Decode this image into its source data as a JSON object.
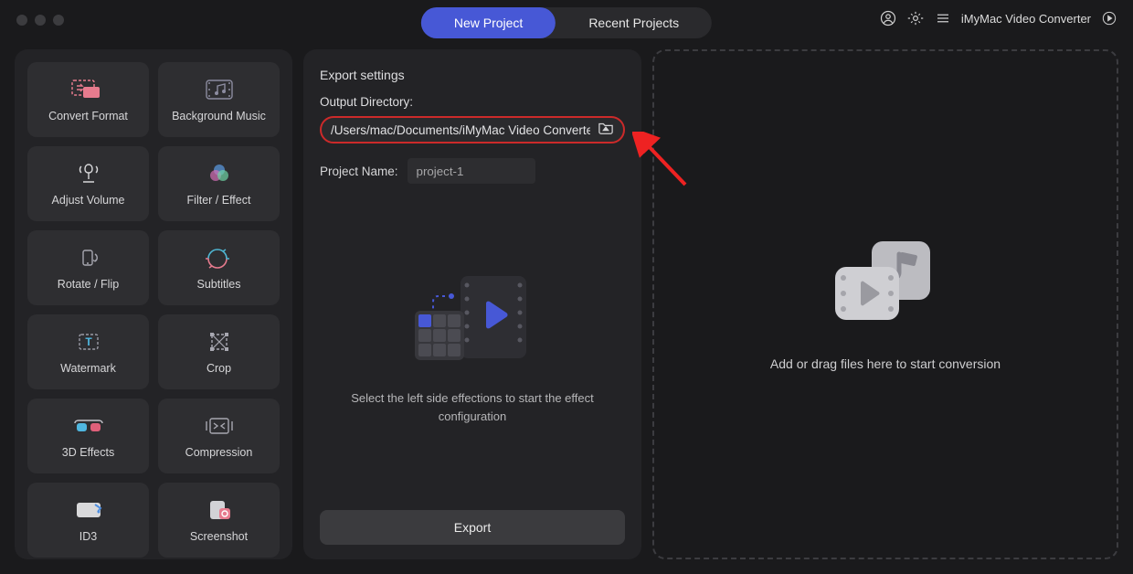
{
  "app_name": "iMyMac Video Converter",
  "tabs": {
    "new_project": "New Project",
    "recent_projects": "Recent Projects"
  },
  "tools": [
    {
      "label": "Convert Format"
    },
    {
      "label": "Background Music"
    },
    {
      "label": "Adjust Volume"
    },
    {
      "label": "Filter / Effect"
    },
    {
      "label": "Rotate / Flip"
    },
    {
      "label": "Subtitles"
    },
    {
      "label": "Watermark"
    },
    {
      "label": "Crop"
    },
    {
      "label": "3D Effects"
    },
    {
      "label": "Compression"
    },
    {
      "label": "ID3"
    },
    {
      "label": "Screenshot"
    }
  ],
  "export": {
    "title": "Export settings",
    "output_dir_label": "Output Directory:",
    "output_dir_value": "/Users/mac/Documents/iMyMac Video Converte",
    "project_name_label": "Project Name:",
    "project_name_value": "project-1",
    "hint": "Select the left side effections to start the effect configuration",
    "export_button": "Export"
  },
  "drop": {
    "hint": "Add or drag files here to start conversion"
  },
  "colors": {
    "accent": "#4758d6",
    "highlight_border": "#cc2a2a"
  }
}
